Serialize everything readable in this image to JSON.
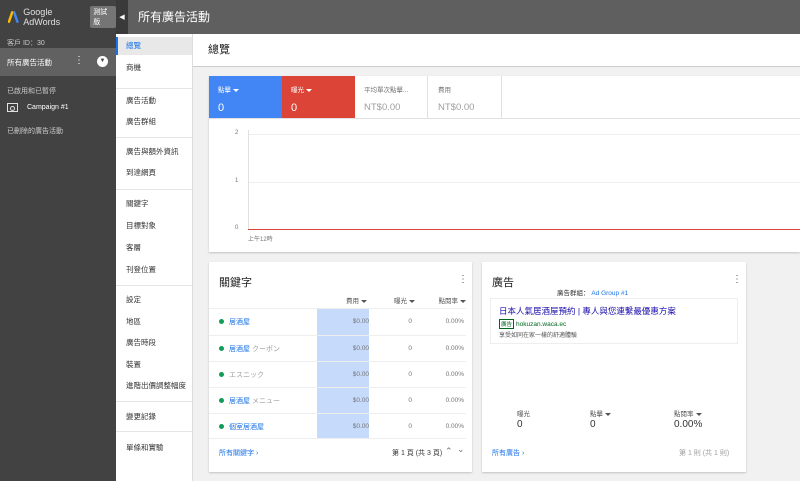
{
  "header": {
    "brand": "Google AdWords",
    "badge": "測試版",
    "title": "所有廣告活動"
  },
  "sidebar": {
    "customer_id": "客戶 ID：30",
    "all_campaigns": "所有廣告活動",
    "filter_label": "已啟用和已暫停",
    "campaign": "Campaign #1",
    "removed": "已刪除的廣告活動"
  },
  "subnav": {
    "items": [
      "總覽",
      "商機",
      "廣告活動",
      "廣告群組",
      "廣告與額外資訊",
      "到達網頁",
      "關鍵字",
      "目標對象",
      "客層",
      "刊登位置",
      "設定",
      "地區",
      "廣告時段",
      "裝置",
      "進階出價調整幅度",
      "變更記錄",
      "單條和實驗"
    ]
  },
  "overview": {
    "title": "總覽",
    "metrics": [
      {
        "label": "點擊",
        "value": "0",
        "color": "#4285f4"
      },
      {
        "label": "曝光",
        "value": "0",
        "color": "#db4437"
      },
      {
        "label": "平均單次點擊...",
        "value": "NT$0.00"
      },
      {
        "label": "費用",
        "value": "NT$0.00"
      }
    ],
    "y_ticks": [
      "2",
      "1",
      "0"
    ],
    "x_tick": "上午12時"
  },
  "keywords_card": {
    "title": "關鍵字",
    "headers": {
      "cost": "費用",
      "impressions": "曝光",
      "ctr": "點閱率"
    },
    "rows": [
      {
        "keyword": "居酒屋",
        "suffix": "",
        "cost": "$0.00",
        "impressions": "0",
        "ctr": "0.00%"
      },
      {
        "keyword": "居酒屋",
        "suffix": "クーポン",
        "cost": "$0.00",
        "impressions": "0",
        "ctr": "0.00%"
      },
      {
        "keyword": "エスニック",
        "suffix": "",
        "cost": "$0.00",
        "impressions": "0",
        "ctr": "0.00%"
      },
      {
        "keyword": "居酒屋",
        "suffix": "メニュー",
        "cost": "$0.00",
        "impressions": "0",
        "ctr": "0.00%"
      },
      {
        "keyword": "個室居酒屋",
        "suffix": "",
        "cost": "$0.00",
        "impressions": "0",
        "ctr": "0.00%"
      }
    ],
    "footer_link": "所有關鍵字",
    "pagination": "第 1 頁 (共 3 頁)"
  },
  "ads_card": {
    "title": "廣告",
    "ad_group_label": "廣告群組：",
    "ad_group_value": "Ad Group #1",
    "ad": {
      "headline": "日本人氣居酒屋預約 | 專人與您連繫最優惠方案",
      "tag": "廣告",
      "url": "hokuzan.waca.ec",
      "description": "享受如同在家一樣的舒適體驗"
    },
    "metrics": [
      {
        "label": "曝光",
        "value": "0"
      },
      {
        "label": "點擊",
        "value": "0"
      },
      {
        "label": "點閱率",
        "value": "0.00%"
      }
    ],
    "footer_link": "所有廣告",
    "pagination": "第 1 則 (共 1 則)"
  },
  "colors": {
    "accent": "#1a73e8",
    "clicks": "#4285f4",
    "impressions": "#db4437",
    "active": "#0f9d58"
  }
}
